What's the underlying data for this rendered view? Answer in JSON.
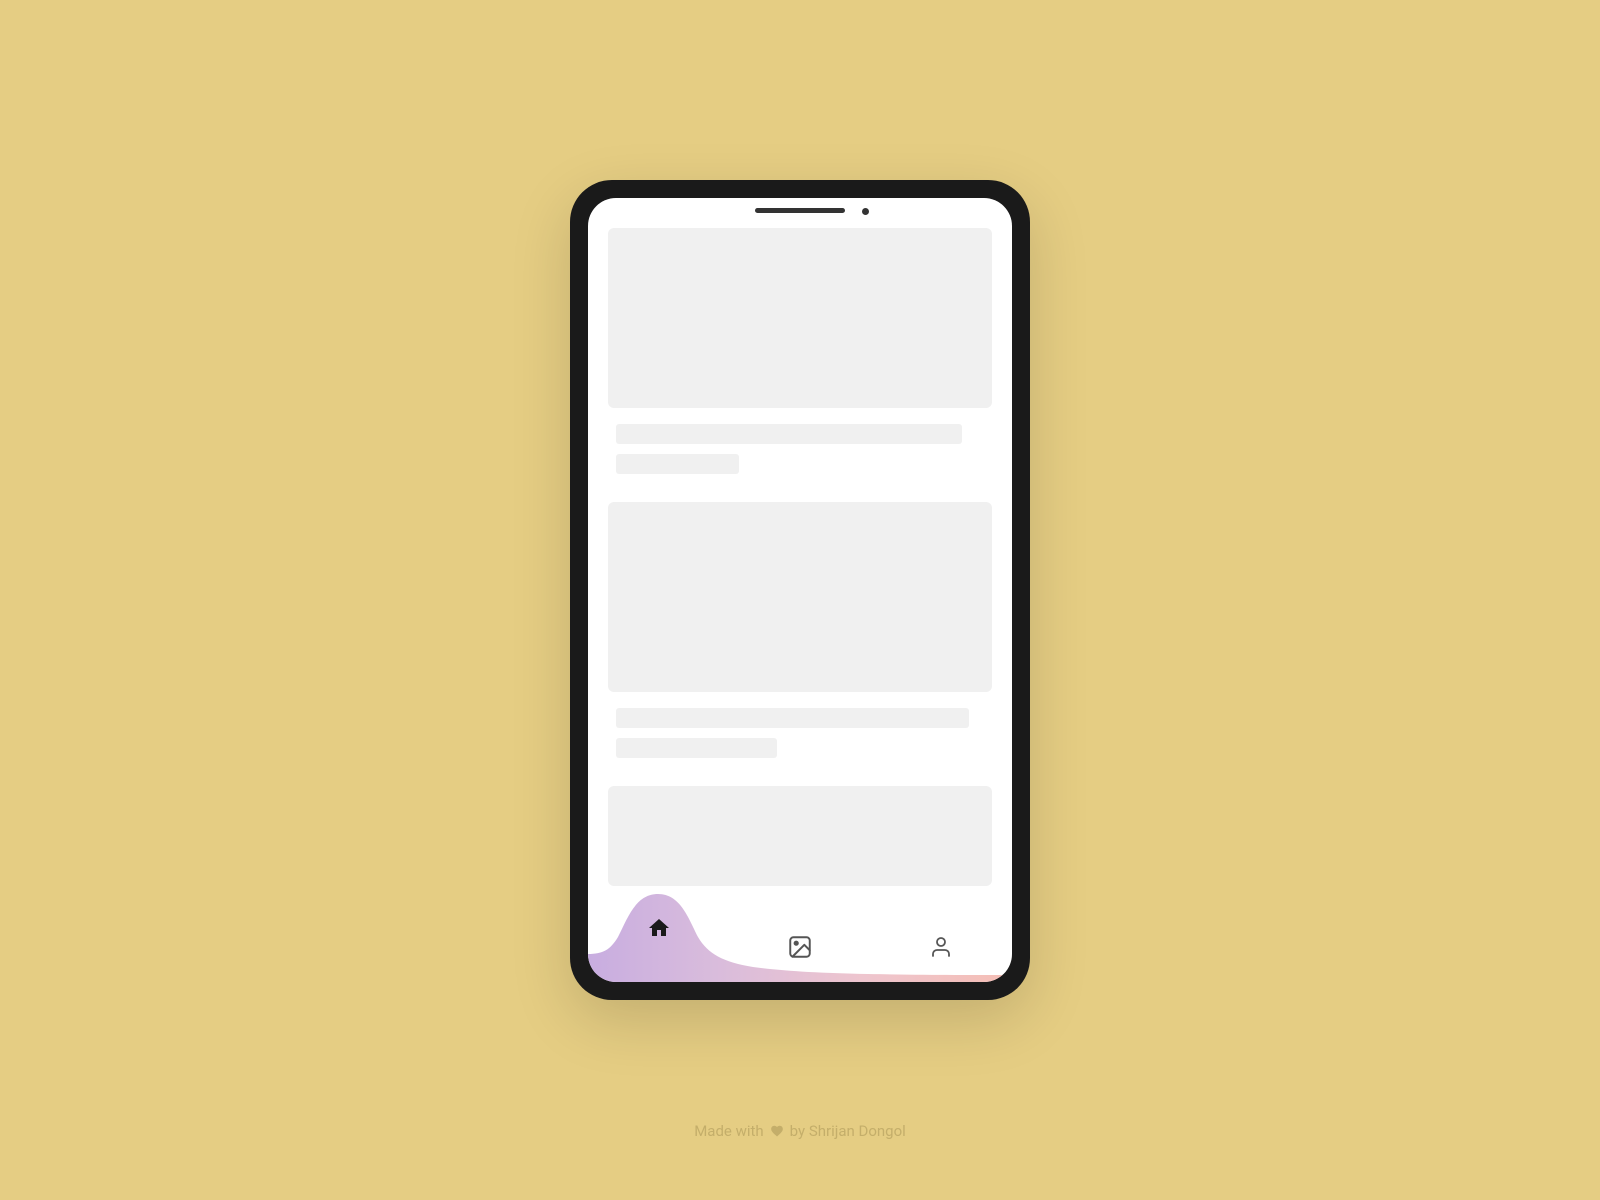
{
  "nav": {
    "items": [
      {
        "name": "home",
        "active": true
      },
      {
        "name": "gallery",
        "active": false
      },
      {
        "name": "profile",
        "active": false
      }
    ]
  },
  "credit": {
    "prefix": "Made with",
    "suffix": "by Shrijan Dongol"
  },
  "colors": {
    "background": "#E5CD83",
    "skeleton": "#f0f0f0",
    "gradientStart": "#D1B7DA",
    "gradientMid": "#E9C3D5",
    "gradientEnd": "#F6BFB6",
    "iconActive": "#1a1a1a",
    "iconInactive": "#666666"
  }
}
